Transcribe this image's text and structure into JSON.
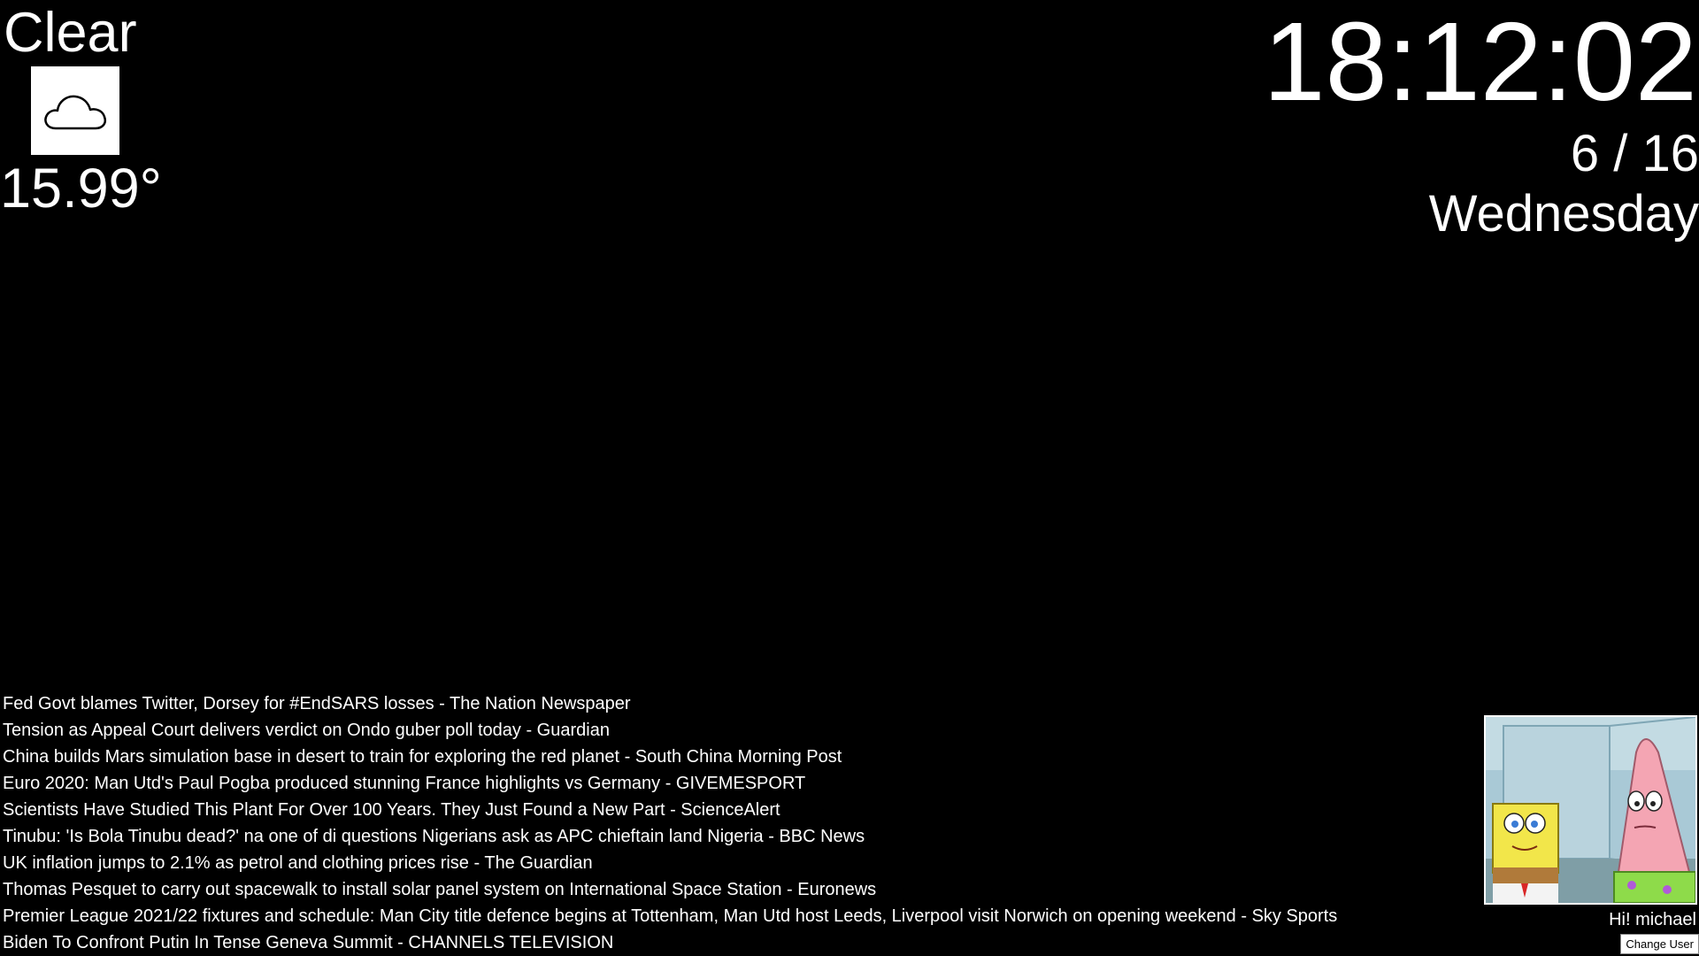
{
  "weather": {
    "condition": "Clear",
    "icon": "cloud-icon",
    "temperature": "15.99°"
  },
  "clock": {
    "time": "18:12:02",
    "date": "6 / 16",
    "day": "Wednesday"
  },
  "news": [
    "Fed Govt blames Twitter, Dorsey for #EndSARS losses - The Nation Newspaper",
    "Tension as Appeal Court delivers verdict on Ondo guber poll today - Guardian",
    "China builds Mars simulation base in desert to train for exploring the red planet - South China Morning Post",
    "Euro 2020: Man Utd's Paul Pogba produced stunning France highlights vs Germany - GIVEMESPORT",
    "Scientists Have Studied This Plant For Over 100 Years. They Just Found a New Part - ScienceAlert",
    "Tinubu: 'Is Bola Tinubu dead?' na one of di questions Nigerians ask as APC chieftain land Nigeria - BBC News",
    "UK inflation jumps to 2.1% as petrol and clothing prices rise - The Guardian",
    "Thomas Pesquet to carry out spacewalk to install solar panel system on International Space Station - Euronews",
    "Premier League 2021/22 fixtures and schedule: Man City title defence begins at Tottenham, Man Utd host Leeds, Liverpool visit Norwich on opening weekend - Sky Sports",
    "Biden To Confront Putin In Tense Geneva Summit - CHANNELS TELEVISION"
  ],
  "user": {
    "greeting": "Hi! michael",
    "change_user_label": "Change User"
  }
}
